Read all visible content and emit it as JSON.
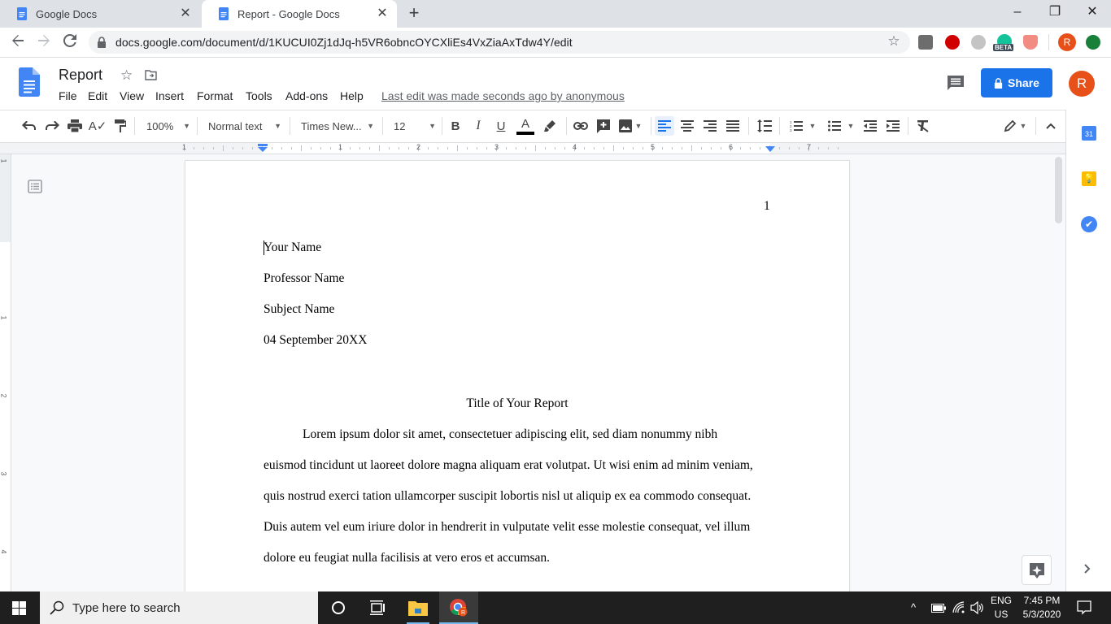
{
  "browser": {
    "tabs": [
      {
        "title": "Google Docs",
        "active": false
      },
      {
        "title": "Report - Google Docs",
        "active": true
      }
    ],
    "new_tab_label": "+",
    "url": "docs.google.com/document/d/1KUCUI0Zj1dJq-h5VR6obncOYCXliEs4VxZiaAxTdw4Y/edit",
    "extensions": [
      "gimp-extension-icon",
      "adblock-icon",
      "ghostery-icon",
      "grammarly-beta-icon",
      "privacy-badger-icon"
    ],
    "extension_badge": "BETA",
    "profile_initial": "R",
    "window_controls": {
      "minimize": "–",
      "restore": "❐",
      "close": "✕"
    }
  },
  "docs": {
    "title": "Report",
    "menu": [
      "File",
      "Edit",
      "View",
      "Insert",
      "Format",
      "Tools",
      "Add-ons",
      "Help"
    ],
    "last_edit": "Last edit was made seconds ago by anonymous",
    "share_label": "Share",
    "account_initial": "R",
    "toolbar": {
      "zoom": "100%",
      "style": "Normal text",
      "font": "Times New...",
      "font_size": "12"
    },
    "ruler_numbers": [
      "1",
      "1",
      "2",
      "3",
      "4",
      "5",
      "6",
      "7"
    ],
    "vruler_numbers": [
      "1",
      "1",
      "2",
      "3",
      "4"
    ]
  },
  "document": {
    "page_number": "1",
    "header_lines": [
      "Your Name",
      "Professor Name",
      "Subject Name",
      "04 September 20XX"
    ],
    "report_title": "Title of Your Report",
    "body_lines": [
      "Lorem ipsum dolor sit amet, consectetuer adipiscing elit, sed diam nonummy nibh",
      "euismod tincidunt ut laoreet dolore magna aliquam erat volutpat. Ut wisi enim ad minim veniam,",
      "quis nostrud exerci tation ullamcorper suscipit lobortis nisl ut aliquip ex ea commodo consequat.",
      "Duis autem vel eum iriure dolor in hendrerit in vulputate velit esse molestie consequat, vel illum",
      "dolore eu feugiat nulla facilisis at vero eros et accumsan."
    ]
  },
  "taskbar": {
    "search_placeholder": "Type here to search",
    "language": "ENG",
    "region": "US",
    "time": "7:45 PM",
    "date": "5/3/2020"
  },
  "colors": {
    "accent": "#1a73e8",
    "avatar": "#e8501a",
    "docs_blue": "#4285f4"
  }
}
